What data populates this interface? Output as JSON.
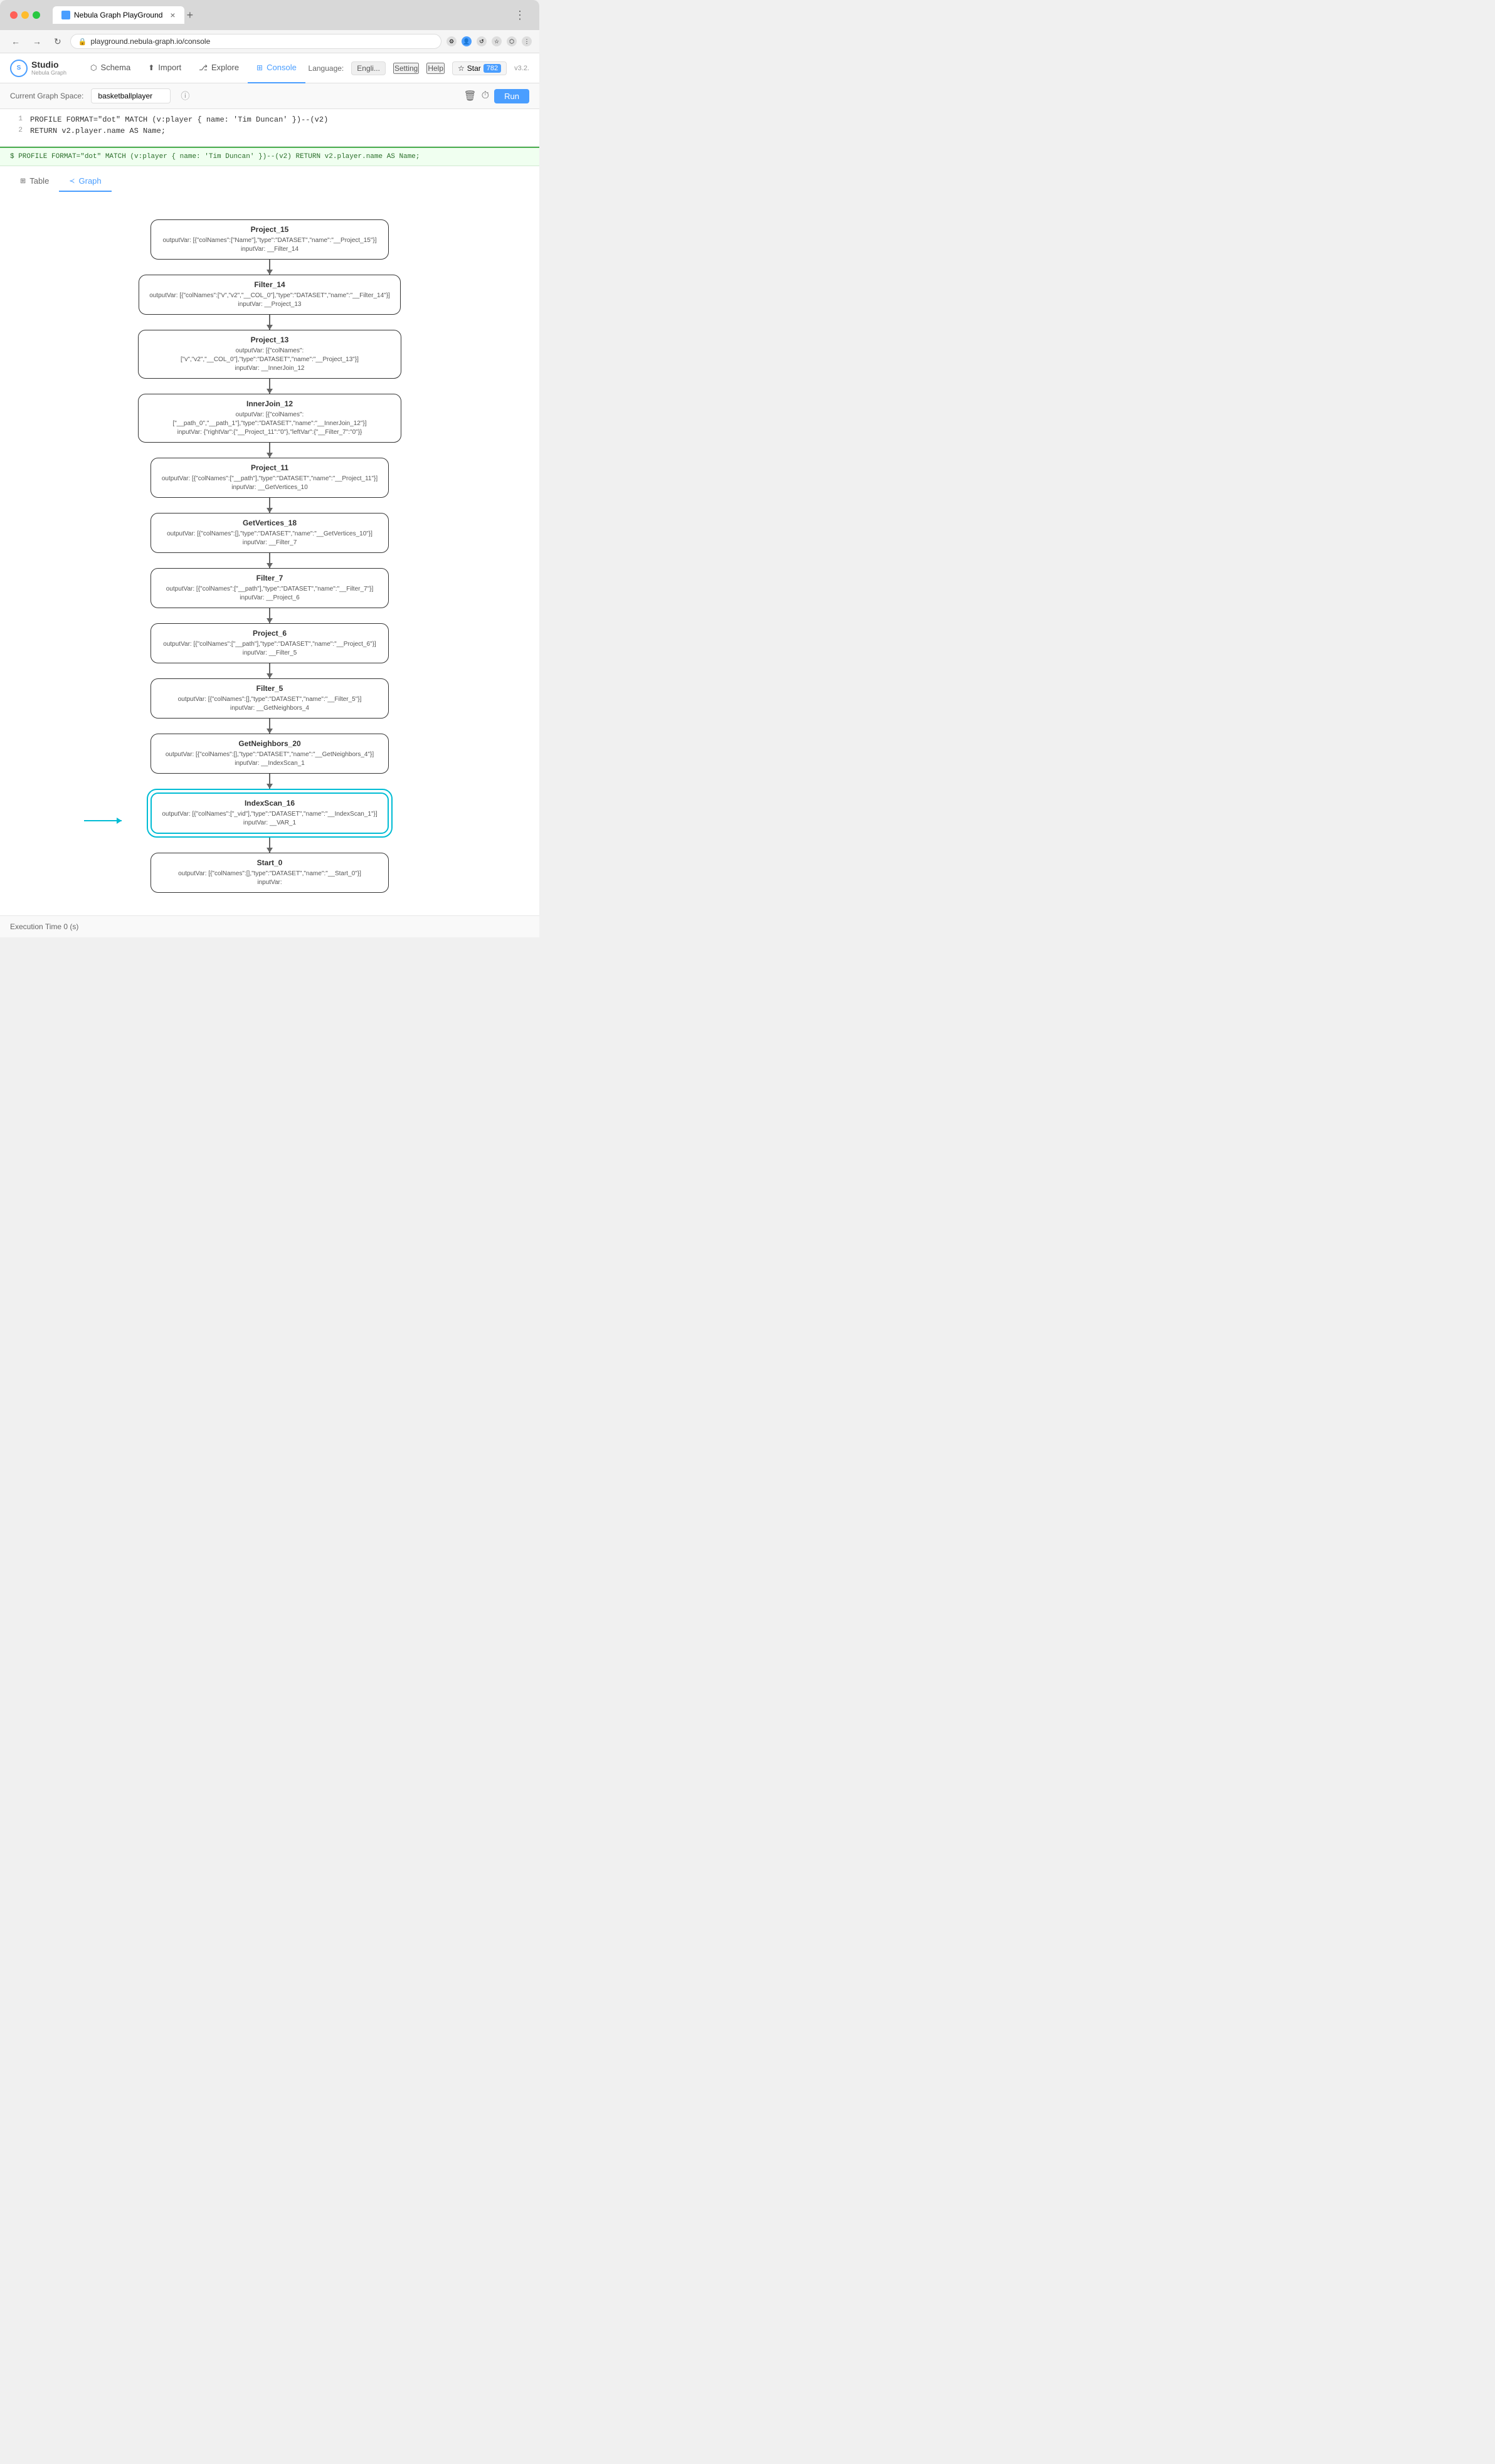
{
  "browser": {
    "tab_title": "Nebula Graph PlayGround",
    "tab_close": "×",
    "new_tab": "+",
    "nav_back": "←",
    "nav_forward": "→",
    "nav_refresh": "↻",
    "address": "playground.nebula-graph.io/console",
    "more_options": "⋮"
  },
  "app": {
    "logo_text": "Studio",
    "logo_sub": "Nebula Graph",
    "nav": {
      "schema": "Schema",
      "import": "Import",
      "explore": "Explore",
      "console": "Console"
    },
    "header_right": {
      "language_label": "Language:",
      "language_value": "Engli...",
      "setting": "Setting",
      "help": "Help",
      "star": "Star",
      "star_count": "782",
      "version": "v3.2."
    }
  },
  "query": {
    "graph_space_label": "Current Graph Space:",
    "graph_space_value": "basketballplayer",
    "line1": "PROFILE FORMAT=\"dot\" MATCH (v:player { name: 'Tim Duncan' })--(v2)",
    "line2": "    RETURN v2.player.name AS Name;",
    "run_btn": "Run"
  },
  "results": {
    "query_display": "$ PROFILE FORMAT=\"dot\" MATCH (v:player { name: 'Tim Duncan' })--(v2) RETURN v2.player.name AS Name;",
    "tab_table": "Table",
    "tab_graph": "Graph"
  },
  "nodes": [
    {
      "id": "project_15",
      "title": "Project_15",
      "outputVar": "outputVar: [{\"colNames\":[\"Name\"],\"type\":\"DATASET\",\"name\":\"__Project_15\"}]",
      "inputVar": "inputVar: __Filter_14"
    },
    {
      "id": "filter_14",
      "title": "Filter_14",
      "outputVar": "outputVar: [{\"colNames\":[\"v\",\"v2\",\"__COL_0\"],\"type\":\"DATASET\",\"name\":\"__Filter_14\"}]",
      "inputVar": "inputVar: __Project_13"
    },
    {
      "id": "project_13",
      "title": "Project_13",
      "outputVar": "outputVar: [{\"colNames\":[\"v\",\"v2\",\"__COL_0\"],\"type\":\"DATASET\",\"name\":\"__Project_13\"}]",
      "inputVar": "inputVar: __InnerJoin_12"
    },
    {
      "id": "innerjoin_12",
      "title": "InnerJoin_12",
      "outputVar": "outputVar: [{\"colNames\":[\"__path_0\",\"__path_1\"],\"type\":\"DATASET\",\"name\":\"__InnerJoin_12\"}]",
      "inputVar": "inputVar: {\"rightVar\":{\"__Project_11\":\"0\"},\"leftVar\":{\"__Filter_7\":\"0\"}}"
    },
    {
      "id": "project_11",
      "title": "Project_11",
      "outputVar": "outputVar: [{\"colNames\":[\"__path\"],\"type\":\"DATASET\",\"name\":\"__Project_11\"}]",
      "inputVar": "inputVar: __GetVertices_10"
    },
    {
      "id": "getvertices_18",
      "title": "GetVertices_18",
      "outputVar": "outputVar: [{\"colNames\":[],\"type\":\"DATASET\",\"name\":\"__GetVertices_10\"}]",
      "inputVar": "inputVar: __Filter_7"
    },
    {
      "id": "filter_7",
      "title": "Filter_7",
      "outputVar": "outputVar: [{\"colNames\":[\"__path\"],\"type\":\"DATASET\",\"name\":\"__Filter_7\"}]",
      "inputVar": "inputVar: __Project_6"
    },
    {
      "id": "project_6",
      "title": "Project_6",
      "outputVar": "outputVar: [{\"colNames\":[\"__path\"],\"type\":\"DATASET\",\"name\":\"__Project_6\"}]",
      "inputVar": "inputVar: __Filter_5"
    },
    {
      "id": "filter_5",
      "title": "Filter_5",
      "outputVar": "outputVar: [{\"colNames\":[],\"type\":\"DATASET\",\"name\":\"__Filter_5\"}]",
      "inputVar": "inputVar: __GetNeighbors_4"
    },
    {
      "id": "getneighbors_20",
      "title": "GetNeighbors_20",
      "outputVar": "outputVar: [{\"colNames\":[],\"type\":\"DATASET\",\"name\":\"__GetNeighbors_4\"}]",
      "inputVar": "inputVar: __IndexScan_1"
    },
    {
      "id": "indexscan_16",
      "title": "IndexScan_16",
      "outputVar": "outputVar: [{\"colNames\":[\"_vid\"],\"type\":\"DATASET\",\"name\":\"__IndexScan_1\"}]",
      "inputVar": "inputVar: __VAR_1",
      "highlighted": true
    },
    {
      "id": "start_0",
      "title": "Start_0",
      "outputVar": "outputVar: [{\"colNames\":[],\"type\":\"DATASET\",\"name\":\"__Start_0\"}]",
      "inputVar": "inputVar:"
    }
  ],
  "footer": {
    "execution_time": "Execution Time 0 (s)"
  }
}
